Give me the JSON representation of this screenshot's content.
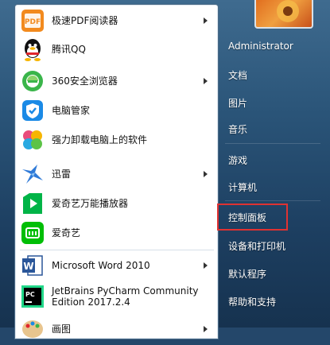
{
  "left_menu": {
    "items": [
      {
        "label": "极速PDF阅读器",
        "icon": "pdf-reader-icon",
        "has_arrow": true
      },
      {
        "label": "腾讯QQ",
        "icon": "qq-penguin-icon",
        "has_arrow": false
      },
      {
        "label": "360安全浏览器",
        "icon": "360-browser-icon",
        "has_arrow": true
      },
      {
        "label": "电脑管家",
        "icon": "pc-manager-shield-icon",
        "has_arrow": false
      },
      {
        "label": "强力卸载电脑上的软件",
        "icon": "uninstaller-icon",
        "has_arrow": false
      },
      {
        "label": "迅雷",
        "icon": "xunlei-bird-icon",
        "has_arrow": true
      },
      {
        "label": "爱奇艺万能播放器",
        "icon": "iqiyi-player-icon",
        "has_arrow": false
      },
      {
        "label": "爱奇艺",
        "icon": "iqiyi-icon",
        "has_arrow": false
      },
      {
        "label": "Microsoft Word 2010",
        "icon": "word-icon",
        "has_arrow": true
      },
      {
        "label_line1": "JetBrains PyCharm Community",
        "label_line2": "Edition 2017.2.4",
        "icon": "pycharm-icon",
        "has_arrow": false
      },
      {
        "label": "画图",
        "icon": "paint-icon",
        "has_arrow": true
      }
    ]
  },
  "right_menu": {
    "items": [
      {
        "label": "Administrator"
      },
      {
        "label": "文档"
      },
      {
        "label": "图片"
      },
      {
        "label": "音乐"
      },
      {
        "label": "游戏"
      },
      {
        "label": "计算机"
      },
      {
        "label": "控制面板"
      },
      {
        "label": "设备和打印机"
      },
      {
        "label": "默认程序"
      },
      {
        "label": "帮助和支持"
      }
    ],
    "highlighted": "控制面板"
  },
  "colors": {
    "highlight_border": "#e03232",
    "panel_bg": "#ffffff",
    "right_bg": "#2a5478"
  }
}
